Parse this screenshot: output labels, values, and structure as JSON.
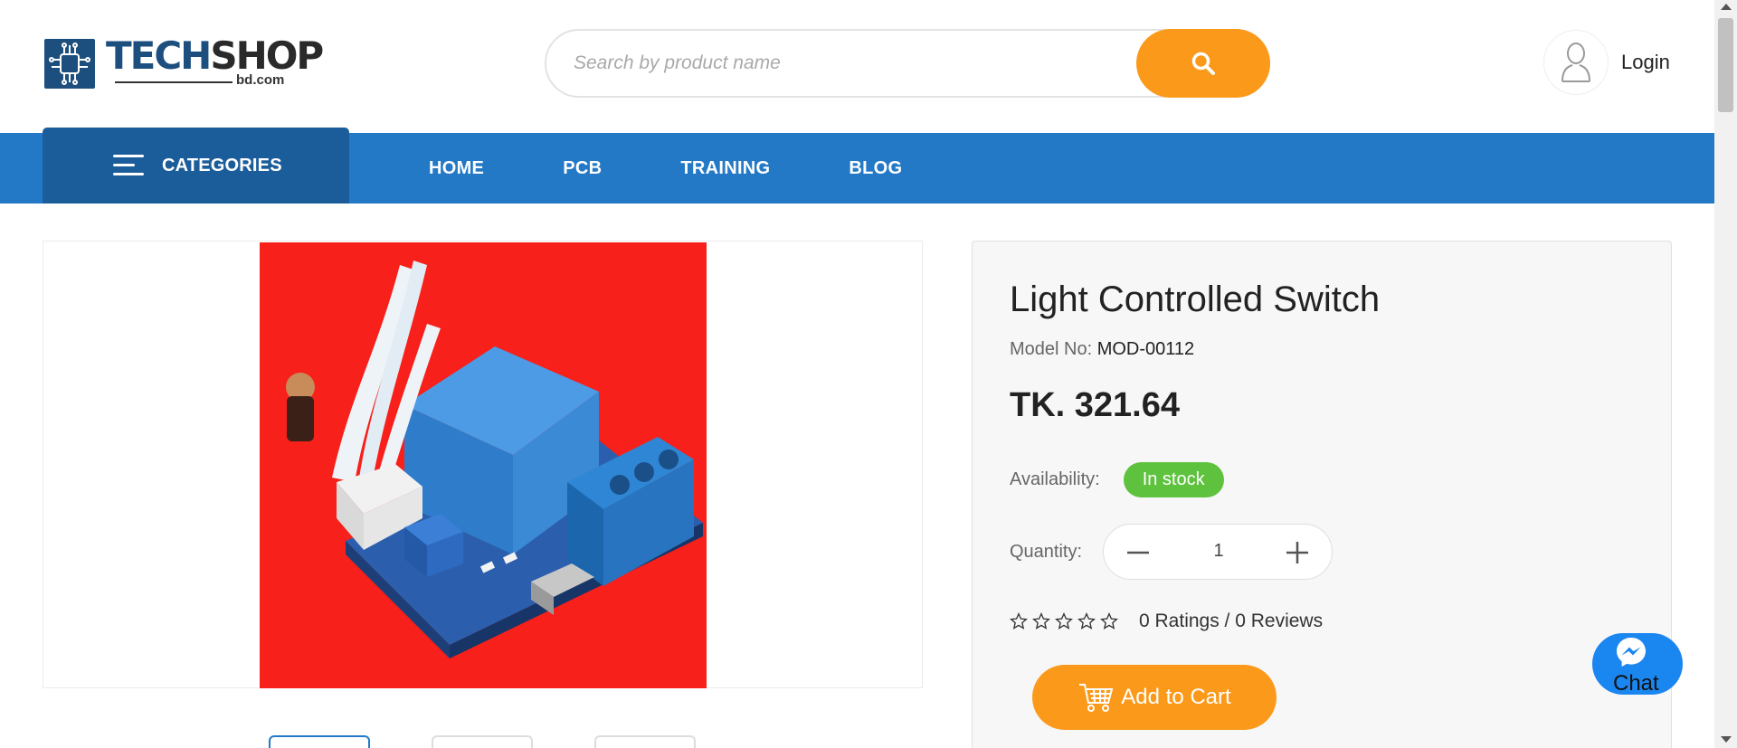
{
  "header": {
    "logo": {
      "brand_primary": "TECH",
      "brand_secondary": "SHOP",
      "domain": "bd.com"
    },
    "search": {
      "placeholder": "Search by product name",
      "value": ""
    },
    "search_icon": "search-icon",
    "login": {
      "label": "Login",
      "icon": "user-icon"
    }
  },
  "nav": {
    "categories_label": "CATEGORIES",
    "links": [
      "HOME",
      "PCB",
      "TRAINING",
      "BLOG"
    ]
  },
  "product": {
    "title": "Light Controlled Switch",
    "model_label": "Model No:",
    "model_value": "MOD-00112",
    "price": "TK. 321.64",
    "availability_label": "Availability:",
    "availability_status": "In stock",
    "quantity_label": "Quantity:",
    "quantity_value": "1",
    "rating_stars": 0,
    "rating_text": "0 Ratings / 0 Reviews",
    "add_to_cart_label": "Add to Cart",
    "image_alt": "product-image"
  },
  "chat": {
    "label": "Chat",
    "icon": "messenger-icon"
  },
  "colors": {
    "brand_blue": "#2379c5",
    "brand_dark_blue": "#1b5d9a",
    "accent_orange": "#fb9a1a",
    "in_stock_green": "#5ec23e",
    "product_bg_red": "#f7201a",
    "chat_blue": "#1a86f0"
  }
}
